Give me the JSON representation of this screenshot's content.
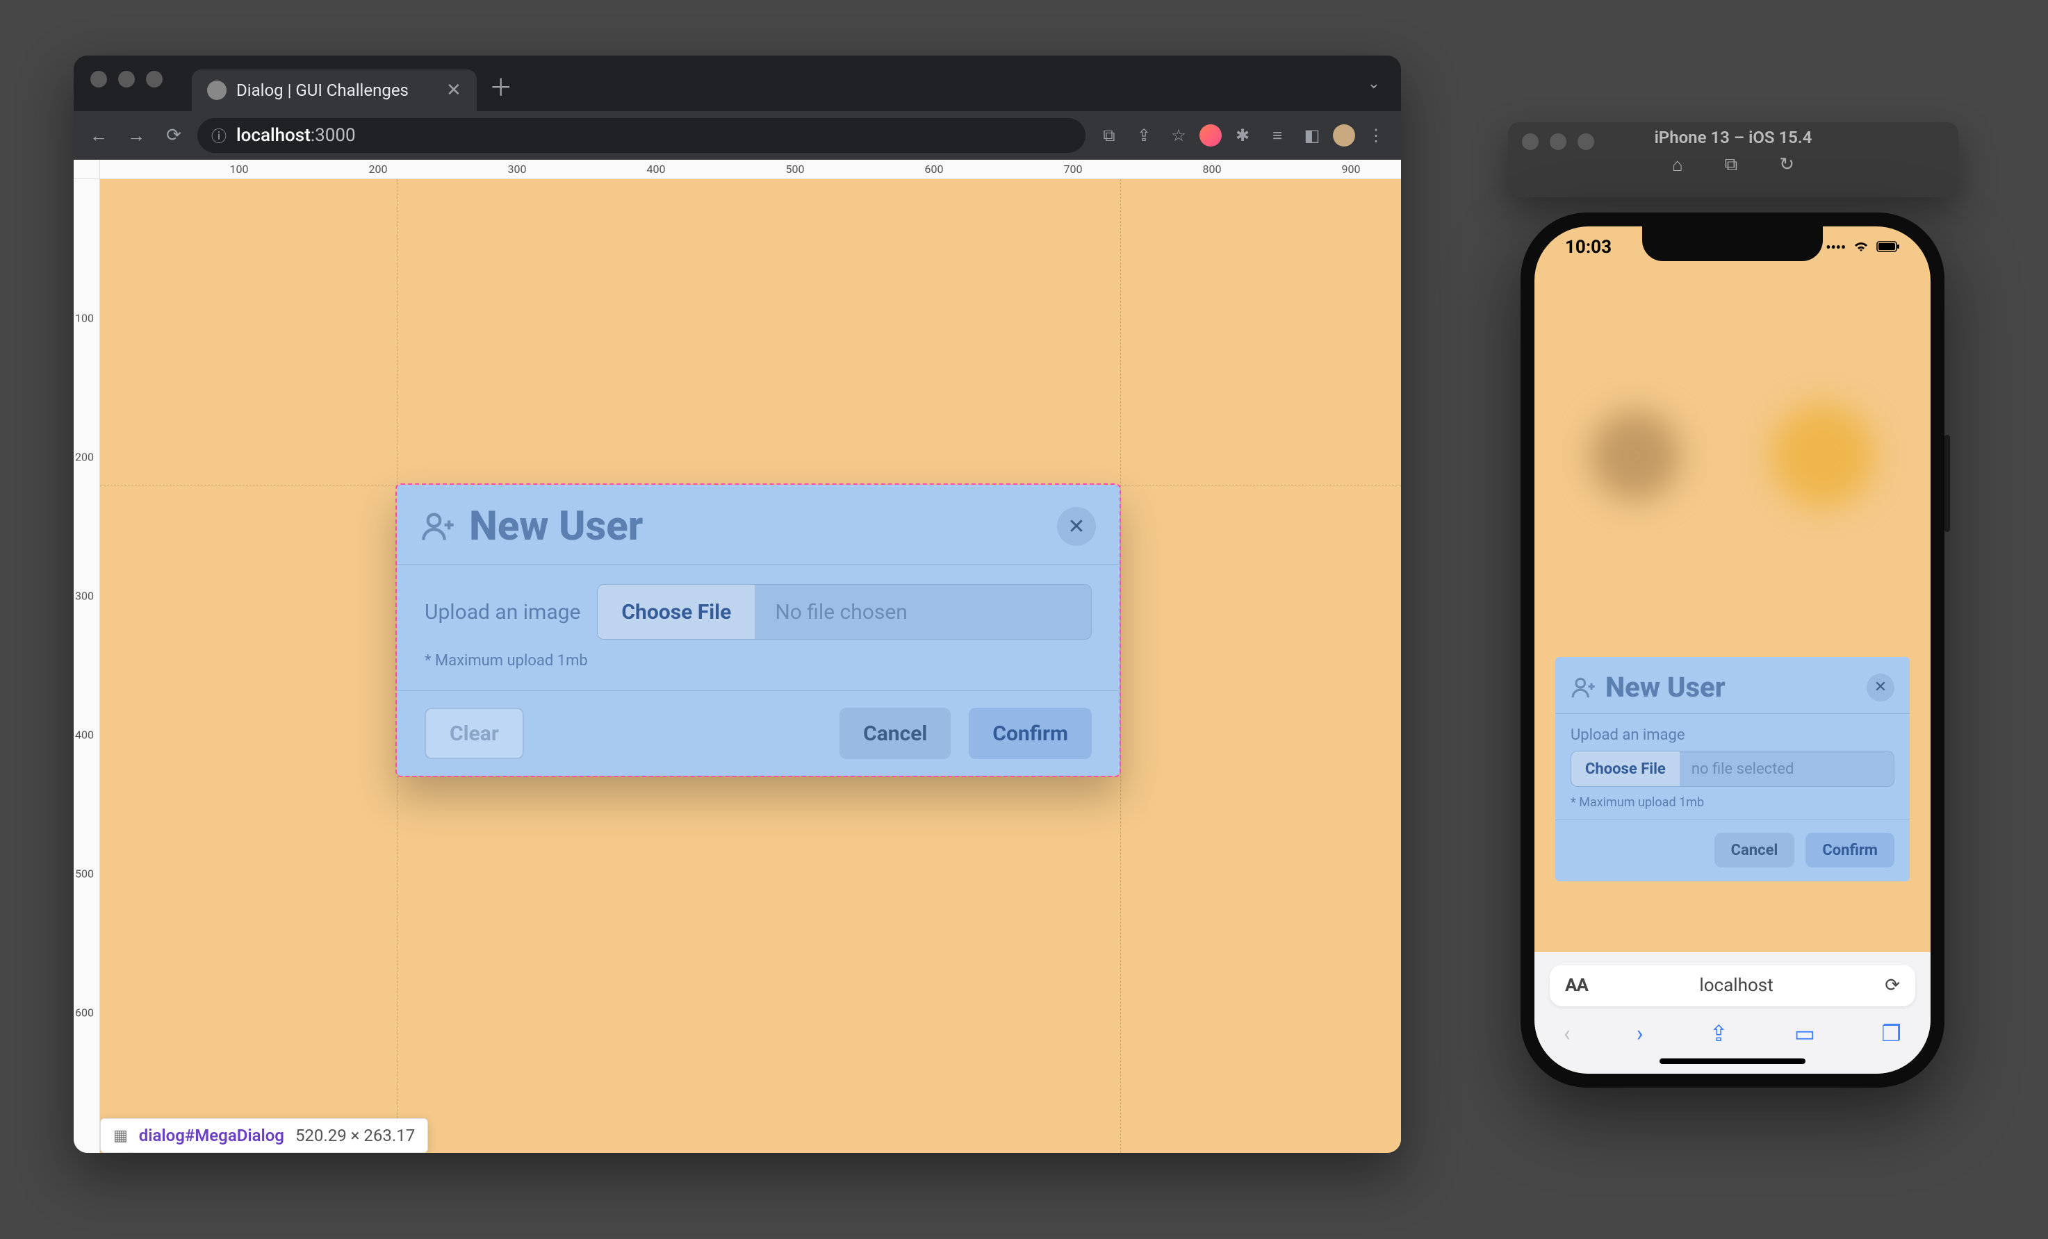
{
  "browser": {
    "tab_title": "Dialog | GUI Challenges",
    "url_host": "localhost",
    "url_port": ":3000"
  },
  "devtools": {
    "ruler_h": [
      "100",
      "200",
      "300",
      "400",
      "500",
      "600",
      "700",
      "800",
      "900"
    ],
    "ruler_v": [
      "100",
      "200",
      "300",
      "400",
      "500",
      "600"
    ],
    "element_selector": "dialog#MegaDialog",
    "element_dims": "520.29 × 263.17"
  },
  "dialog": {
    "title": "New User",
    "upload_label": "Upload an image",
    "choose_file": "Choose File",
    "no_file": "No file chosen",
    "hint": "* Maximum upload 1mb",
    "clear": "Clear",
    "cancel": "Cancel",
    "confirm": "Confirm"
  },
  "simulator": {
    "title": "iPhone 13 – iOS 15.4"
  },
  "phone": {
    "time": "10:03",
    "url": "localhost"
  },
  "mdialog": {
    "title": "New User",
    "upload_label": "Upload an image",
    "choose_file": "Choose File",
    "no_file": "no file selected",
    "hint": "* Maximum upload 1mb",
    "cancel": "Cancel",
    "confirm": "Confirm"
  }
}
